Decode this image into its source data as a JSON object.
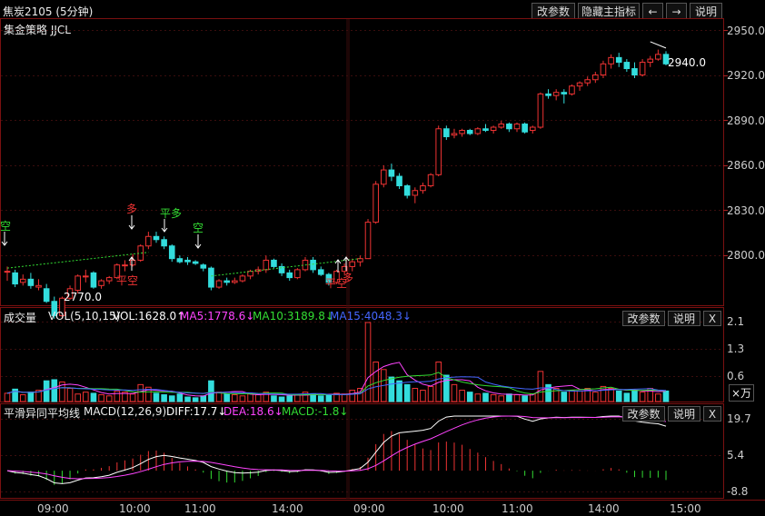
{
  "header": {
    "title": "焦炭2105 (5分钟)",
    "strategy": "集金策略 JJCL",
    "buttons": {
      "params": "改参数",
      "hide_indicator": "隐藏主指标",
      "prev": "←",
      "next": "→",
      "help": "说明"
    }
  },
  "price_axis": {
    "ticks": [
      "2950.0",
      "2920.0",
      "2890.0",
      "2860.0",
      "2830.0",
      "2800.0"
    ]
  },
  "annotations": {
    "high_label": "2940.0",
    "low_label": "2770.0",
    "signals": [
      {
        "text": "空",
        "color": "#33dd33"
      },
      {
        "text": "多",
        "color": "#ee3333"
      },
      {
        "text": "平空",
        "color": "#ee3333"
      },
      {
        "text": "平多",
        "color": "#33dd33"
      },
      {
        "text": "空",
        "color": "#33dd33"
      },
      {
        "text": "平空",
        "color": "#ee3333"
      },
      {
        "text": "多",
        "color": "#ee3333"
      }
    ]
  },
  "volume_pane": {
    "name": "成交量",
    "params": "VOL(5,10,15)",
    "vol": "VOL:1628.0↑",
    "ma5": "MA5:1778.6↓",
    "ma10": "MA10:3189.8↓",
    "ma15": "MA15:4048.3↓",
    "buttons": {
      "params": "改参数",
      "help": "说明",
      "close": "X"
    },
    "ticks": [
      "2.1",
      "1.3",
      "0.6"
    ],
    "unit": "×万"
  },
  "macd_pane": {
    "name": "平滑异同平均线",
    "params": "MACD(12,26,9)",
    "diff": "DIFF:17.7↓",
    "dea": "DEA:18.6↓",
    "macd": "MACD:-1.8↓",
    "buttons": {
      "params": "改参数",
      "help": "说明",
      "close": "X"
    },
    "ticks": [
      "19.7",
      "5.4",
      "-8.8"
    ]
  },
  "time_axis": {
    "labels": [
      "09:00",
      "10:00",
      "11:00",
      "14:00",
      "09:00",
      "10:00",
      "11:00",
      "14:00",
      "15:00"
    ]
  },
  "colors": {
    "up": "#ee3333",
    "down": "#33dddd",
    "ma5": "#ff44ff",
    "ma10": "#33dd33",
    "ma15": "#4466ff",
    "diff": "#ffffff",
    "dea": "#ff44ff"
  },
  "chart_data": {
    "type": "candlestick",
    "symbol": "焦炭2105",
    "interval": "5分钟",
    "price_range": [
      2780,
      2955
    ],
    "candles": [
      [
        2798,
        2801,
        2792,
        2798
      ],
      [
        2797,
        2799,
        2788,
        2790
      ],
      [
        2791,
        2796,
        2789,
        2793
      ],
      [
        2793,
        2797,
        2787,
        2789
      ],
      [
        2788,
        2793,
        2786,
        2789
      ],
      [
        2787,
        2790,
        2778,
        2779
      ],
      [
        2779,
        2782,
        2768,
        2770
      ],
      [
        2770,
        2782,
        2768,
        2781
      ],
      [
        2781,
        2789,
        2780,
        2787
      ],
      [
        2786,
        2796,
        2784,
        2795
      ],
      [
        2795,
        2799,
        2791,
        2795
      ],
      [
        2797,
        2798,
        2787,
        2788
      ],
      [
        2789,
        2793,
        2787,
        2792
      ],
      [
        2792,
        2795,
        2790,
        2794
      ],
      [
        2794,
        2803,
        2793,
        2802
      ],
      [
        2802,
        2805,
        2798,
        2802
      ],
      [
        2802,
        2809,
        2801,
        2805
      ],
      [
        2805,
        2815,
        2804,
        2814
      ],
      [
        2814,
        2823,
        2812,
        2820
      ],
      [
        2820,
        2823,
        2816,
        2818
      ],
      [
        2818,
        2820,
        2812,
        2814
      ],
      [
        2814,
        2815,
        2804,
        2806
      ],
      [
        2806,
        2808,
        2803,
        2804
      ],
      [
        2805,
        2807,
        2802,
        2804
      ],
      [
        2804,
        2805,
        2802,
        2803
      ],
      [
        2802,
        2803,
        2798,
        2800
      ],
      [
        2800,
        2801,
        2786,
        2788
      ],
      [
        2788,
        2793,
        2787,
        2792
      ],
      [
        2792,
        2794,
        2789,
        2791
      ],
      [
        2791,
        2794,
        2790,
        2792
      ],
      [
        2792,
        2796,
        2791,
        2795
      ],
      [
        2795,
        2799,
        2793,
        2798
      ],
      [
        2798,
        2801,
        2796,
        2799
      ],
      [
        2799,
        2808,
        2797,
        2805
      ],
      [
        2805,
        2806,
        2800,
        2801
      ],
      [
        2801,
        2803,
        2795,
        2797
      ],
      [
        2797,
        2799,
        2792,
        2794
      ],
      [
        2794,
        2800,
        2793,
        2799
      ],
      [
        2799,
        2807,
        2798,
        2805
      ],
      [
        2805,
        2807,
        2797,
        2799
      ],
      [
        2799,
        2801,
        2795,
        2796
      ],
      [
        2796,
        2797,
        2789,
        2791
      ],
      [
        2791,
        2799,
        2790,
        2798
      ],
      [
        2798,
        2803,
        2796,
        2801
      ],
      [
        2801,
        2806,
        2798,
        2804
      ],
      [
        2804,
        2808,
        2801,
        2806
      ],
      [
        2806,
        2831,
        2806,
        2829
      ],
      [
        2829,
        2855,
        2828,
        2853
      ],
      [
        2853,
        2865,
        2851,
        2862
      ],
      [
        2862,
        2866,
        2855,
        2858
      ],
      [
        2858,
        2860,
        2850,
        2852
      ],
      [
        2852,
        2853,
        2844,
        2846
      ],
      [
        2846,
        2851,
        2841,
        2849
      ],
      [
        2849,
        2854,
        2847,
        2852
      ],
      [
        2852,
        2860,
        2851,
        2859
      ],
      [
        2859,
        2890,
        2858,
        2888
      ],
      [
        2888,
        2890,
        2881,
        2883
      ],
      [
        2884,
        2888,
        2882,
        2885
      ],
      [
        2885,
        2888,
        2883,
        2887
      ],
      [
        2887,
        2888,
        2884,
        2885
      ],
      [
        2885,
        2889,
        2884,
        2888
      ],
      [
        2888,
        2891,
        2886,
        2887
      ],
      [
        2887,
        2890,
        2885,
        2889
      ],
      [
        2889,
        2893,
        2888,
        2891
      ],
      [
        2891,
        2892,
        2886,
        2888
      ],
      [
        2888,
        2892,
        2886,
        2891
      ],
      [
        2891,
        2892,
        2885,
        2886
      ],
      [
        2887,
        2890,
        2885,
        2889
      ],
      [
        2889,
        2911,
        2888,
        2910
      ],
      [
        2910,
        2913,
        2907,
        2909
      ],
      [
        2909,
        2913,
        2906,
        2911
      ],
      [
        2911,
        2913,
        2904,
        2910
      ],
      [
        2910,
        2916,
        2909,
        2915
      ],
      [
        2915,
        2918,
        2912,
        2917
      ],
      [
        2917,
        2921,
        2915,
        2919
      ],
      [
        2919,
        2924,
        2917,
        2922
      ],
      [
        2922,
        2931,
        2920,
        2929
      ],
      [
        2929,
        2935,
        2926,
        2933
      ],
      [
        2933,
        2936,
        2927,
        2930
      ],
      [
        2930,
        2932,
        2924,
        2926
      ],
      [
        2926,
        2930,
        2920,
        2922
      ],
      [
        2922,
        2932,
        2921,
        2930
      ],
      [
        2930,
        2934,
        2927,
        2932
      ],
      [
        2932,
        2938,
        2931,
        2935
      ],
      [
        2935,
        2937,
        2928,
        2929
      ]
    ],
    "volume": [
      0.22,
      0.33,
      0.18,
      0.25,
      0.3,
      0.55,
      0.58,
      0.52,
      0.35,
      0.2,
      0.25,
      0.22,
      0.18,
      0.15,
      0.28,
      0.25,
      0.2,
      0.45,
      0.38,
      0.22,
      0.18,
      0.15,
      0.2,
      0.12,
      0.1,
      0.15,
      0.55,
      0.25,
      0.2,
      0.18,
      0.15,
      0.2,
      0.18,
      0.25,
      0.15,
      0.12,
      0.15,
      0.18,
      0.25,
      0.2,
      0.15,
      0.18,
      0.22,
      0.2,
      0.3,
      0.35,
      2.1,
      1.05,
      0.85,
      0.65,
      0.55,
      0.45,
      0.35,
      0.3,
      0.4,
      1.05,
      0.7,
      0.45,
      0.3,
      0.25,
      0.2,
      0.22,
      0.18,
      0.15,
      0.2,
      0.18,
      0.15,
      0.2,
      0.8,
      0.45,
      0.35,
      0.25,
      0.3,
      0.28,
      0.35,
      0.25,
      0.4,
      0.35,
      0.28,
      0.22,
      0.3,
      0.25,
      0.35,
      0.2,
      0.28
    ],
    "macd_range": [
      -8.8,
      19.7
    ]
  }
}
